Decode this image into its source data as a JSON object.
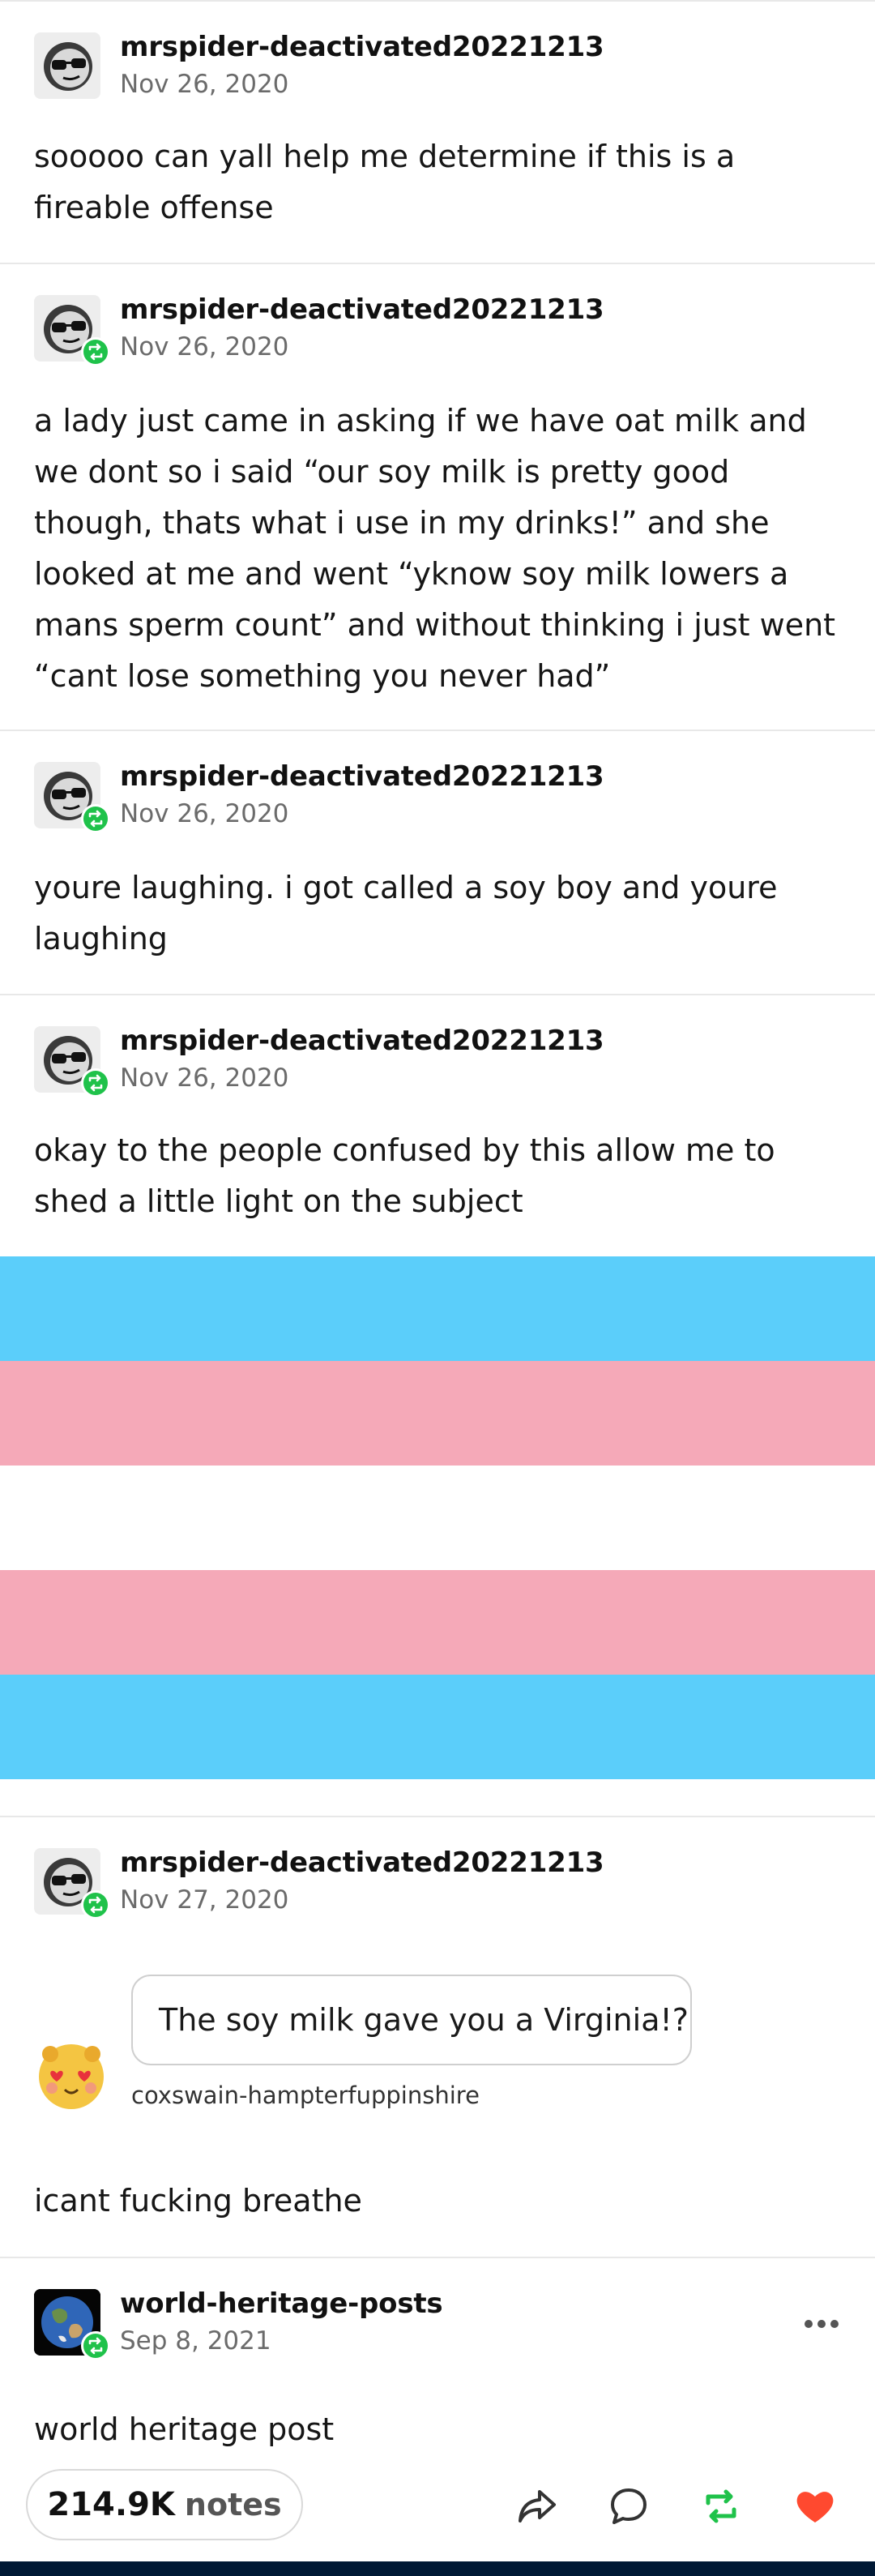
{
  "posts": [
    {
      "username": "mrspider-deactivated20221213",
      "date": "Nov 26, 2020",
      "text": "sooooo can yall help me determine if this is a fireable offense",
      "reblog": false
    },
    {
      "username": "mrspider-deactivated20221213",
      "date": "Nov 26, 2020",
      "text": "a lady just came in asking if we have oat milk and we dont so i said “our soy milk is pretty good though, thats what i use in my drinks!” and she looked at me and went “yknow soy milk lowers a mans sperm count” and without thinking i just went “cant lose something you never had”",
      "reblog": true
    },
    {
      "username": "mrspider-deactivated20221213",
      "date": "Nov 26, 2020",
      "text": "youre laughing. i got called a soy boy and youre laughing",
      "reblog": true
    },
    {
      "username": "mrspider-deactivated20221213",
      "date": "Nov 26, 2020",
      "text": "okay to the people confused by this allow me to shed a little light on the subject",
      "reblog": true
    },
    {
      "username": "mrspider-deactivated20221213",
      "date": "Nov 27, 2020",
      "text": "icant fucking breathe",
      "reblog": true,
      "ask": {
        "question": "The soy milk gave you a Virginia!?",
        "asker": "coxswain-hampterfuppinshire"
      }
    },
    {
      "username": "world-heritage-posts",
      "date": "Sep 8, 2021",
      "text": "world heritage post",
      "reblog": true
    }
  ],
  "flag_colors": [
    "#5bcefa",
    "#f5a9b8",
    "#ffffff",
    "#f5a9b8",
    "#5bcefa"
  ],
  "footer": {
    "notes_count": "214.9K",
    "notes_word": "notes",
    "actions": [
      "share-icon",
      "reply-icon",
      "reblog-icon",
      "like-icon"
    ]
  },
  "colors": {
    "reblog_green": "#1fc24a",
    "like_red": "#ff492f",
    "date_gray": "#6b6b6b"
  }
}
